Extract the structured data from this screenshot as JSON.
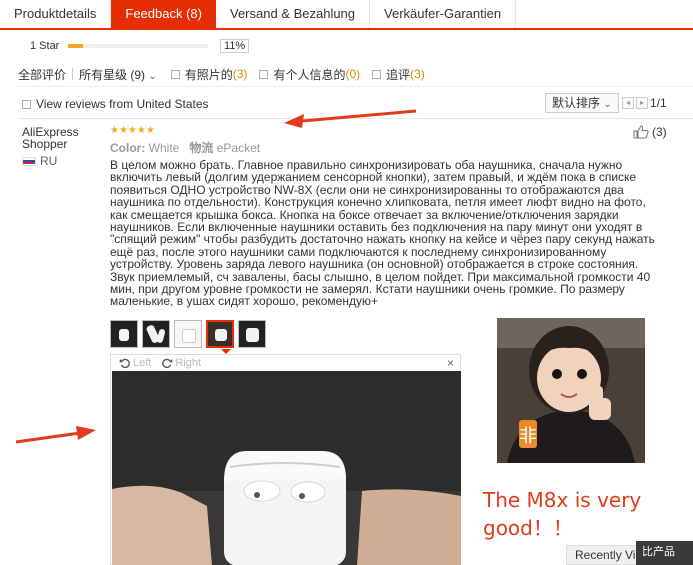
{
  "tabs": [
    {
      "label": "Produktdetails"
    },
    {
      "label": "Feedback (8)"
    },
    {
      "label": "Versand & Bezahlung"
    },
    {
      "label": "Verkäufer-Garantien"
    }
  ],
  "rating_row": {
    "label": "1 Star",
    "percent_text": "11%",
    "fill_fraction": 0.11
  },
  "filters": {
    "all_label": "全部评价",
    "stars_label": "所有星级",
    "stars_count": "(9)",
    "stars_caret": "⌄",
    "with_photos_label": "有照片的",
    "with_photos_count": "(3)",
    "personal_info_label": "有个人信息的",
    "personal_info_count": "(0)",
    "followup_label": "追评",
    "followup_count": "(3)"
  },
  "view_row": {
    "us_reviews_label": "View reviews from United States",
    "sort_label": "默认排序",
    "sort_caret": "⌄",
    "prev_glyph": "◂",
    "next_glyph": "▸",
    "page_text": "1/1"
  },
  "review": {
    "user_name_line1": "AliExpress",
    "user_name_line2": "Shopper",
    "country_code": "RU",
    "stars": "★★★★★",
    "color_label": "Color:",
    "color_value": "White",
    "shipping_label": "物流",
    "shipping_value": "ePacket",
    "likes": "(3)",
    "text": "В целом можно брать. Главное правильно синхронизировать оба наушника, сначала нужно включить левый (долгим удержанием сенсорной кнопки), затем правый, и ждём пока в списке появиться ОДНО устройство NW-8X (если они не синхронизированны то отображаются два наушника по отдельности). Конструкция конечно хлипковата, петля имеет люфт видно на фото, как смещается крышка бокса. Кнопка на боксе отвечает за включение/отключения зарядки наушников. Если включенные наушники оставить без подключения на пару минут они уходят в \"спящий режим\" чтобы разбудить достаточно нажать кнопку на кейсе и чёрез пару секунд нажать ещё раз, после этого наушники сами подключаются к последнему синхронизированному устройству. Уровень заряда левого наушника (он основной) отображается в строке состояния. Звук приемлемый, сч завалены, басы слышно, в целом пойдет. При максимальной громкости 40 мин, при другом уровне громкости не замерял. Кстати наушники очень громкие. По размеру маленькие, в ушах сидят хорошо, рекомендую+"
  },
  "viewer": {
    "rotate_left": "Left",
    "rotate_right": "Right",
    "close_glyph": "×"
  },
  "caption": {
    "line1": "The M8x is very",
    "line2": "good！！"
  },
  "footer": {
    "recently_viewed": "Recently Viewed",
    "compare": "比产品"
  },
  "colors": {
    "accent": "#e62e04",
    "star": "#f5a623",
    "count": "#e08a00",
    "annotation": "#e23b1b"
  },
  "icons": {
    "like": "thumbs-up-icon",
    "rotate_left": "rotate-left-icon",
    "rotate_right": "rotate-right-icon",
    "close": "close-icon",
    "flag": "russia-flag-icon"
  }
}
